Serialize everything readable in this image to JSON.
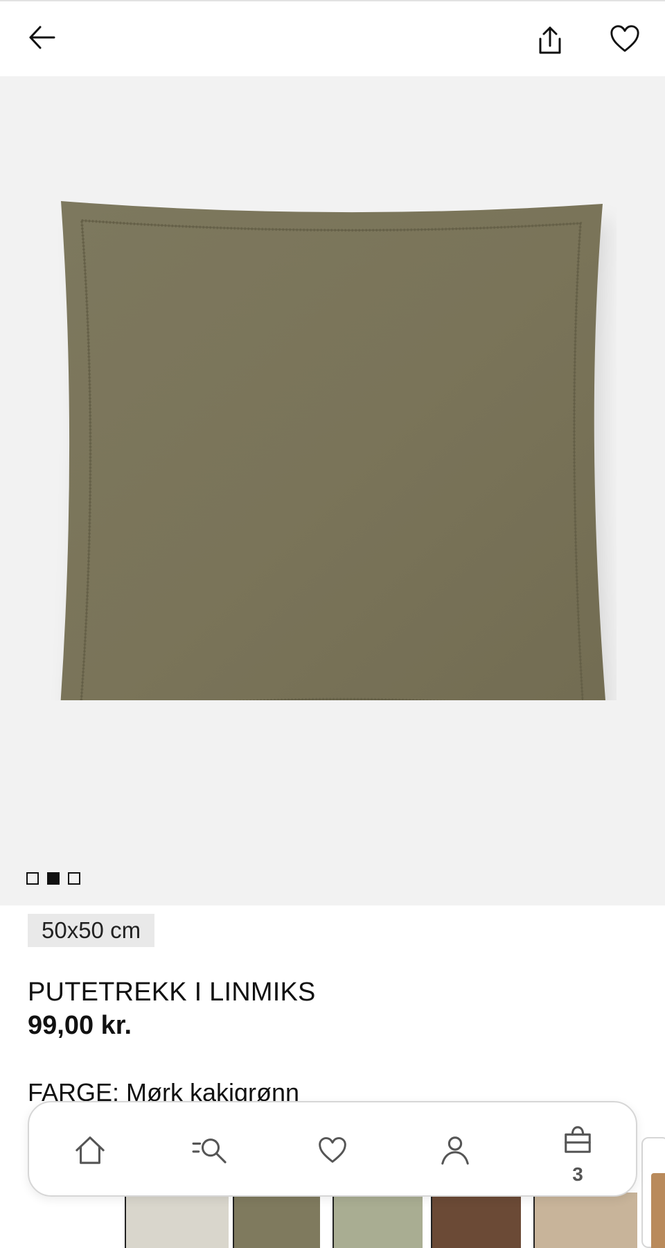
{
  "header": {
    "back_icon": "arrow-left-icon",
    "share_icon": "share-icon",
    "favorite_icon": "heart-icon"
  },
  "gallery": {
    "image_alt": "cushion-image",
    "pages": 3,
    "active_page": 2
  },
  "product": {
    "size": "50x50 cm",
    "title": "PUTETREKK I LINMIKS",
    "price": "99,00 kr.",
    "color_label": "FARGE: Mørk kakigrønn"
  },
  "swatches": [
    {
      "color": "#d9d6cc"
    },
    {
      "color": "#7f7a5e"
    },
    {
      "color": "#a9ad92"
    },
    {
      "color": "#6b4a36"
    },
    {
      "color": "#c8b49a"
    }
  ],
  "bottom_nav": {
    "items": [
      {
        "name": "home",
        "icon": "home-icon"
      },
      {
        "name": "search",
        "icon": "search-icon"
      },
      {
        "name": "favorites",
        "icon": "heart-icon"
      },
      {
        "name": "account",
        "icon": "user-icon"
      },
      {
        "name": "bag",
        "icon": "shopping-bag-icon"
      }
    ],
    "bag_count": "3"
  },
  "colors": {
    "accent": "#111111",
    "gallery_bg": "#f2f2f2",
    "cushion": "#7b765c",
    "chip_bg": "#e9e9e9"
  }
}
